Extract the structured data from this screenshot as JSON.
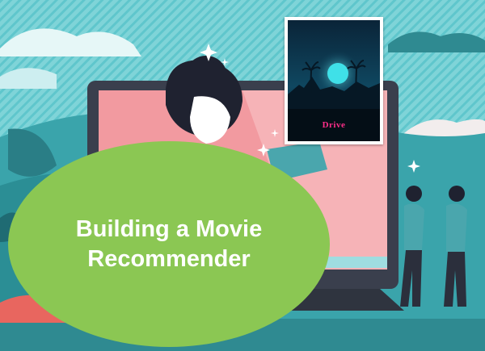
{
  "banner": {
    "title": "Building a Movie Recommender"
  },
  "poster": {
    "word": "Drive",
    "word_color": "#ff2e8a"
  },
  "colors": {
    "sky_stripes": "#5fc6cc",
    "ellipse_green": "#8bc753",
    "laptop_screen": "#f29aa0",
    "laptop_frame": "#3a3f4d",
    "figure_teal": "#4aa6ad",
    "poster_night": "#0d2f4a",
    "poster_moon": "#3fe0e8"
  },
  "icons": [
    "sparkle-icon"
  ]
}
